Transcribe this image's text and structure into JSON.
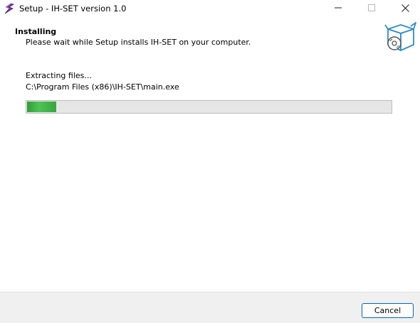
{
  "window": {
    "title": "Setup - IH-SET version 1.0",
    "app_icon": "setup-wizard-icon",
    "controls": [
      "minimize-icon",
      "maximize-icon",
      "close-icon"
    ]
  },
  "header": {
    "title": "Installing",
    "subtitle": "Please wait while Setup installs IH-SET on your computer.",
    "icon": "install-box-disc-icon"
  },
  "status": {
    "label": "Extracting files...",
    "file_path": "C:\\Program Files (x86)\\IH-SET\\main.exe"
  },
  "progress": {
    "fraction": 0.08,
    "fill_color": "#35a83d",
    "track_color": "#e6e6e6"
  },
  "footer": {
    "cancel_label": "Cancel",
    "accent_color": "#0067c0"
  }
}
